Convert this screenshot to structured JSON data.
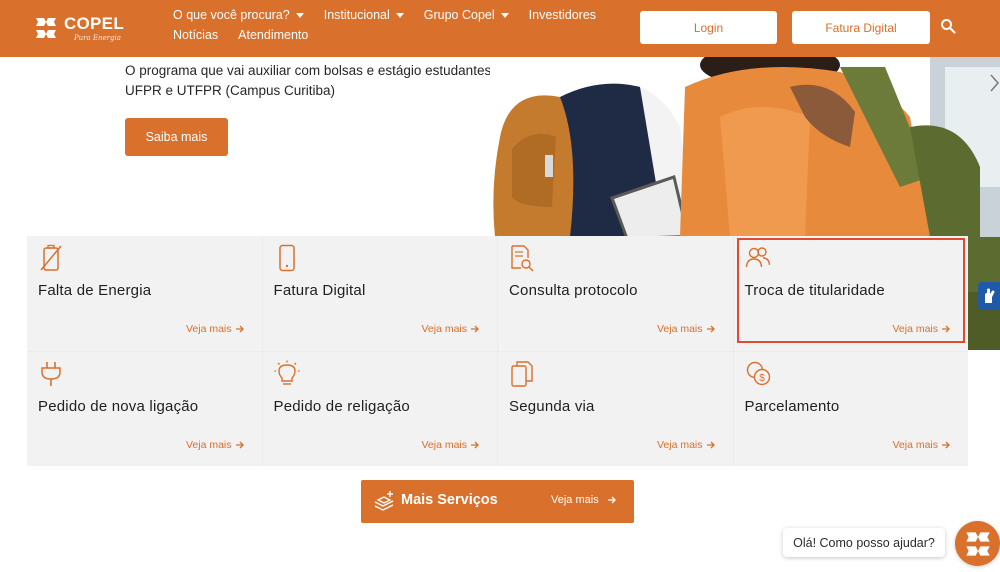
{
  "header": {
    "logo": {
      "name": "COPEL",
      "tagline": "Pura Energia"
    },
    "nav": [
      {
        "label": "O que você procura?",
        "has_dropdown": true
      },
      {
        "label": "Institucional",
        "has_dropdown": true
      },
      {
        "label": "Grupo Copel",
        "has_dropdown": true
      },
      {
        "label": "Investidores",
        "has_dropdown": false
      },
      {
        "label": "Notícias",
        "has_dropdown": false
      },
      {
        "label": "Atendimento",
        "has_dropdown": false
      }
    ],
    "login_label": "Login",
    "fatura_label": "Fatura Digital",
    "search_icon": "search-icon"
  },
  "hero": {
    "text": "O programa que vai auxiliar com bolsas e estágio estudantes cotistas da UFPR e UTFPR (Campus Curitiba)",
    "cta_label": "Saiba mais"
  },
  "services": [
    {
      "title": "Falta de Energia",
      "more": "Veja mais",
      "icon": "no-energy-icon"
    },
    {
      "title": "Fatura Digital",
      "more": "Veja mais",
      "icon": "phone-icon"
    },
    {
      "title": "Consulta protocolo",
      "more": "Veja mais",
      "icon": "document-search-icon"
    },
    {
      "title": "Troca de titularidade",
      "more": "Veja mais",
      "icon": "users-icon",
      "highlighted": true
    },
    {
      "title": "Pedido de nova ligação",
      "more": "Veja mais",
      "icon": "plug-icon"
    },
    {
      "title": "Pedido de religação",
      "more": "Veja mais",
      "icon": "lightbulb-icon"
    },
    {
      "title": "Segunda via",
      "more": "Veja mais",
      "icon": "copy-document-icon"
    },
    {
      "title": "Parcelamento",
      "more": "Veja mais",
      "icon": "coins-icon"
    }
  ],
  "mais_servicos": {
    "label": "Mais Serviços",
    "more": "Veja mais",
    "icon": "hand-stack-icon"
  },
  "chat": {
    "greeting": "Olá! Como posso ajudar?"
  },
  "colors": {
    "brand": "#d9702b",
    "highlight": "#e04a2e",
    "card_bg": "#f2f2f2"
  }
}
